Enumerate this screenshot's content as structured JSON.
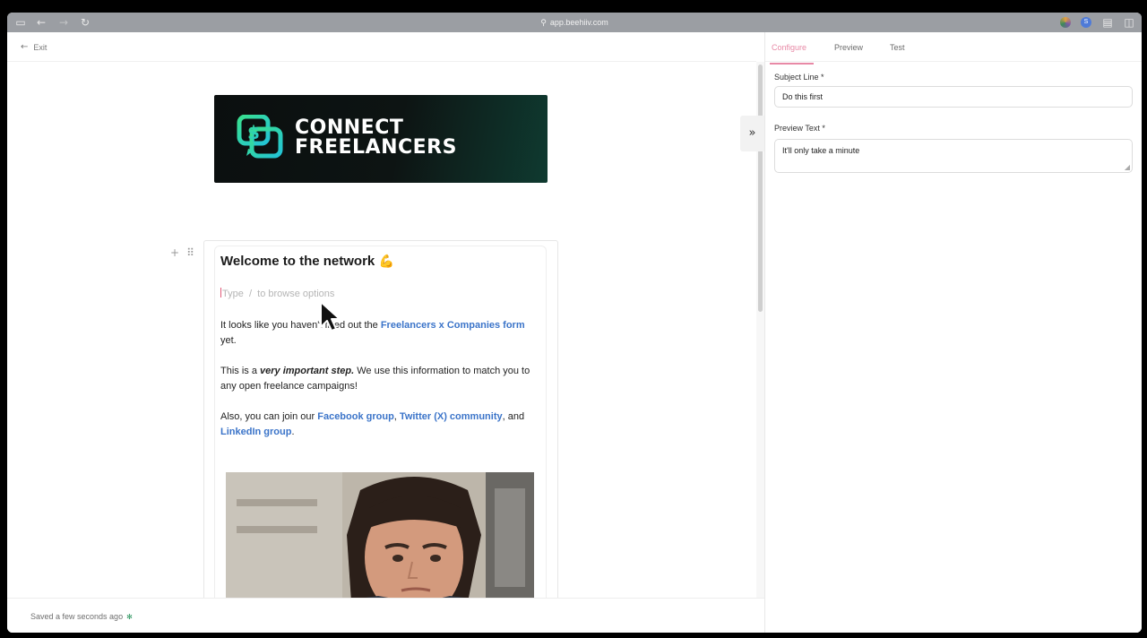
{
  "browser": {
    "url": "app.beehiiv.com",
    "extension_badge": "S"
  },
  "editor": {
    "exit_label": "Exit",
    "banner": {
      "line1": "CONNECT",
      "line2": "FREELANCERS",
      "logo_glyph": "$"
    },
    "heading": "Welcome to the network",
    "heading_emoji": "💪",
    "placeholder_word": "Type",
    "placeholder_slash": "/",
    "placeholder_rest": "to browse options",
    "para1": {
      "prefix": "It looks like you haven't filled out the ",
      "link": "Freelancers x Companies form",
      "suffix": " yet."
    },
    "para2": {
      "prefix": "This is a ",
      "emph": "very important step.",
      "suffix": " We use this information to match you to any open freelance campaigns!"
    },
    "para3": {
      "prefix": "Also, you can join our ",
      "link1": "Facebook group",
      "sep1": ", ",
      "link2": "Twitter (X) community",
      "sep2": ", and ",
      "link3": "LinkedIn group",
      "suffix": "."
    },
    "status": "Saved a few seconds ago",
    "status_dot": "✻",
    "collapse_glyph": "»"
  },
  "panel": {
    "tabs": [
      {
        "label": "Configure"
      },
      {
        "label": "Preview"
      },
      {
        "label": "Test"
      }
    ],
    "subject_label": "Subject Line *",
    "subject_value": "Do this first",
    "preview_label": "Preview Text *",
    "preview_value": "It'll only take a minute"
  },
  "colors": {
    "accent_pink": "#e889a6",
    "link_blue": "#3b74c9",
    "brand_green": "#2fd68a"
  }
}
